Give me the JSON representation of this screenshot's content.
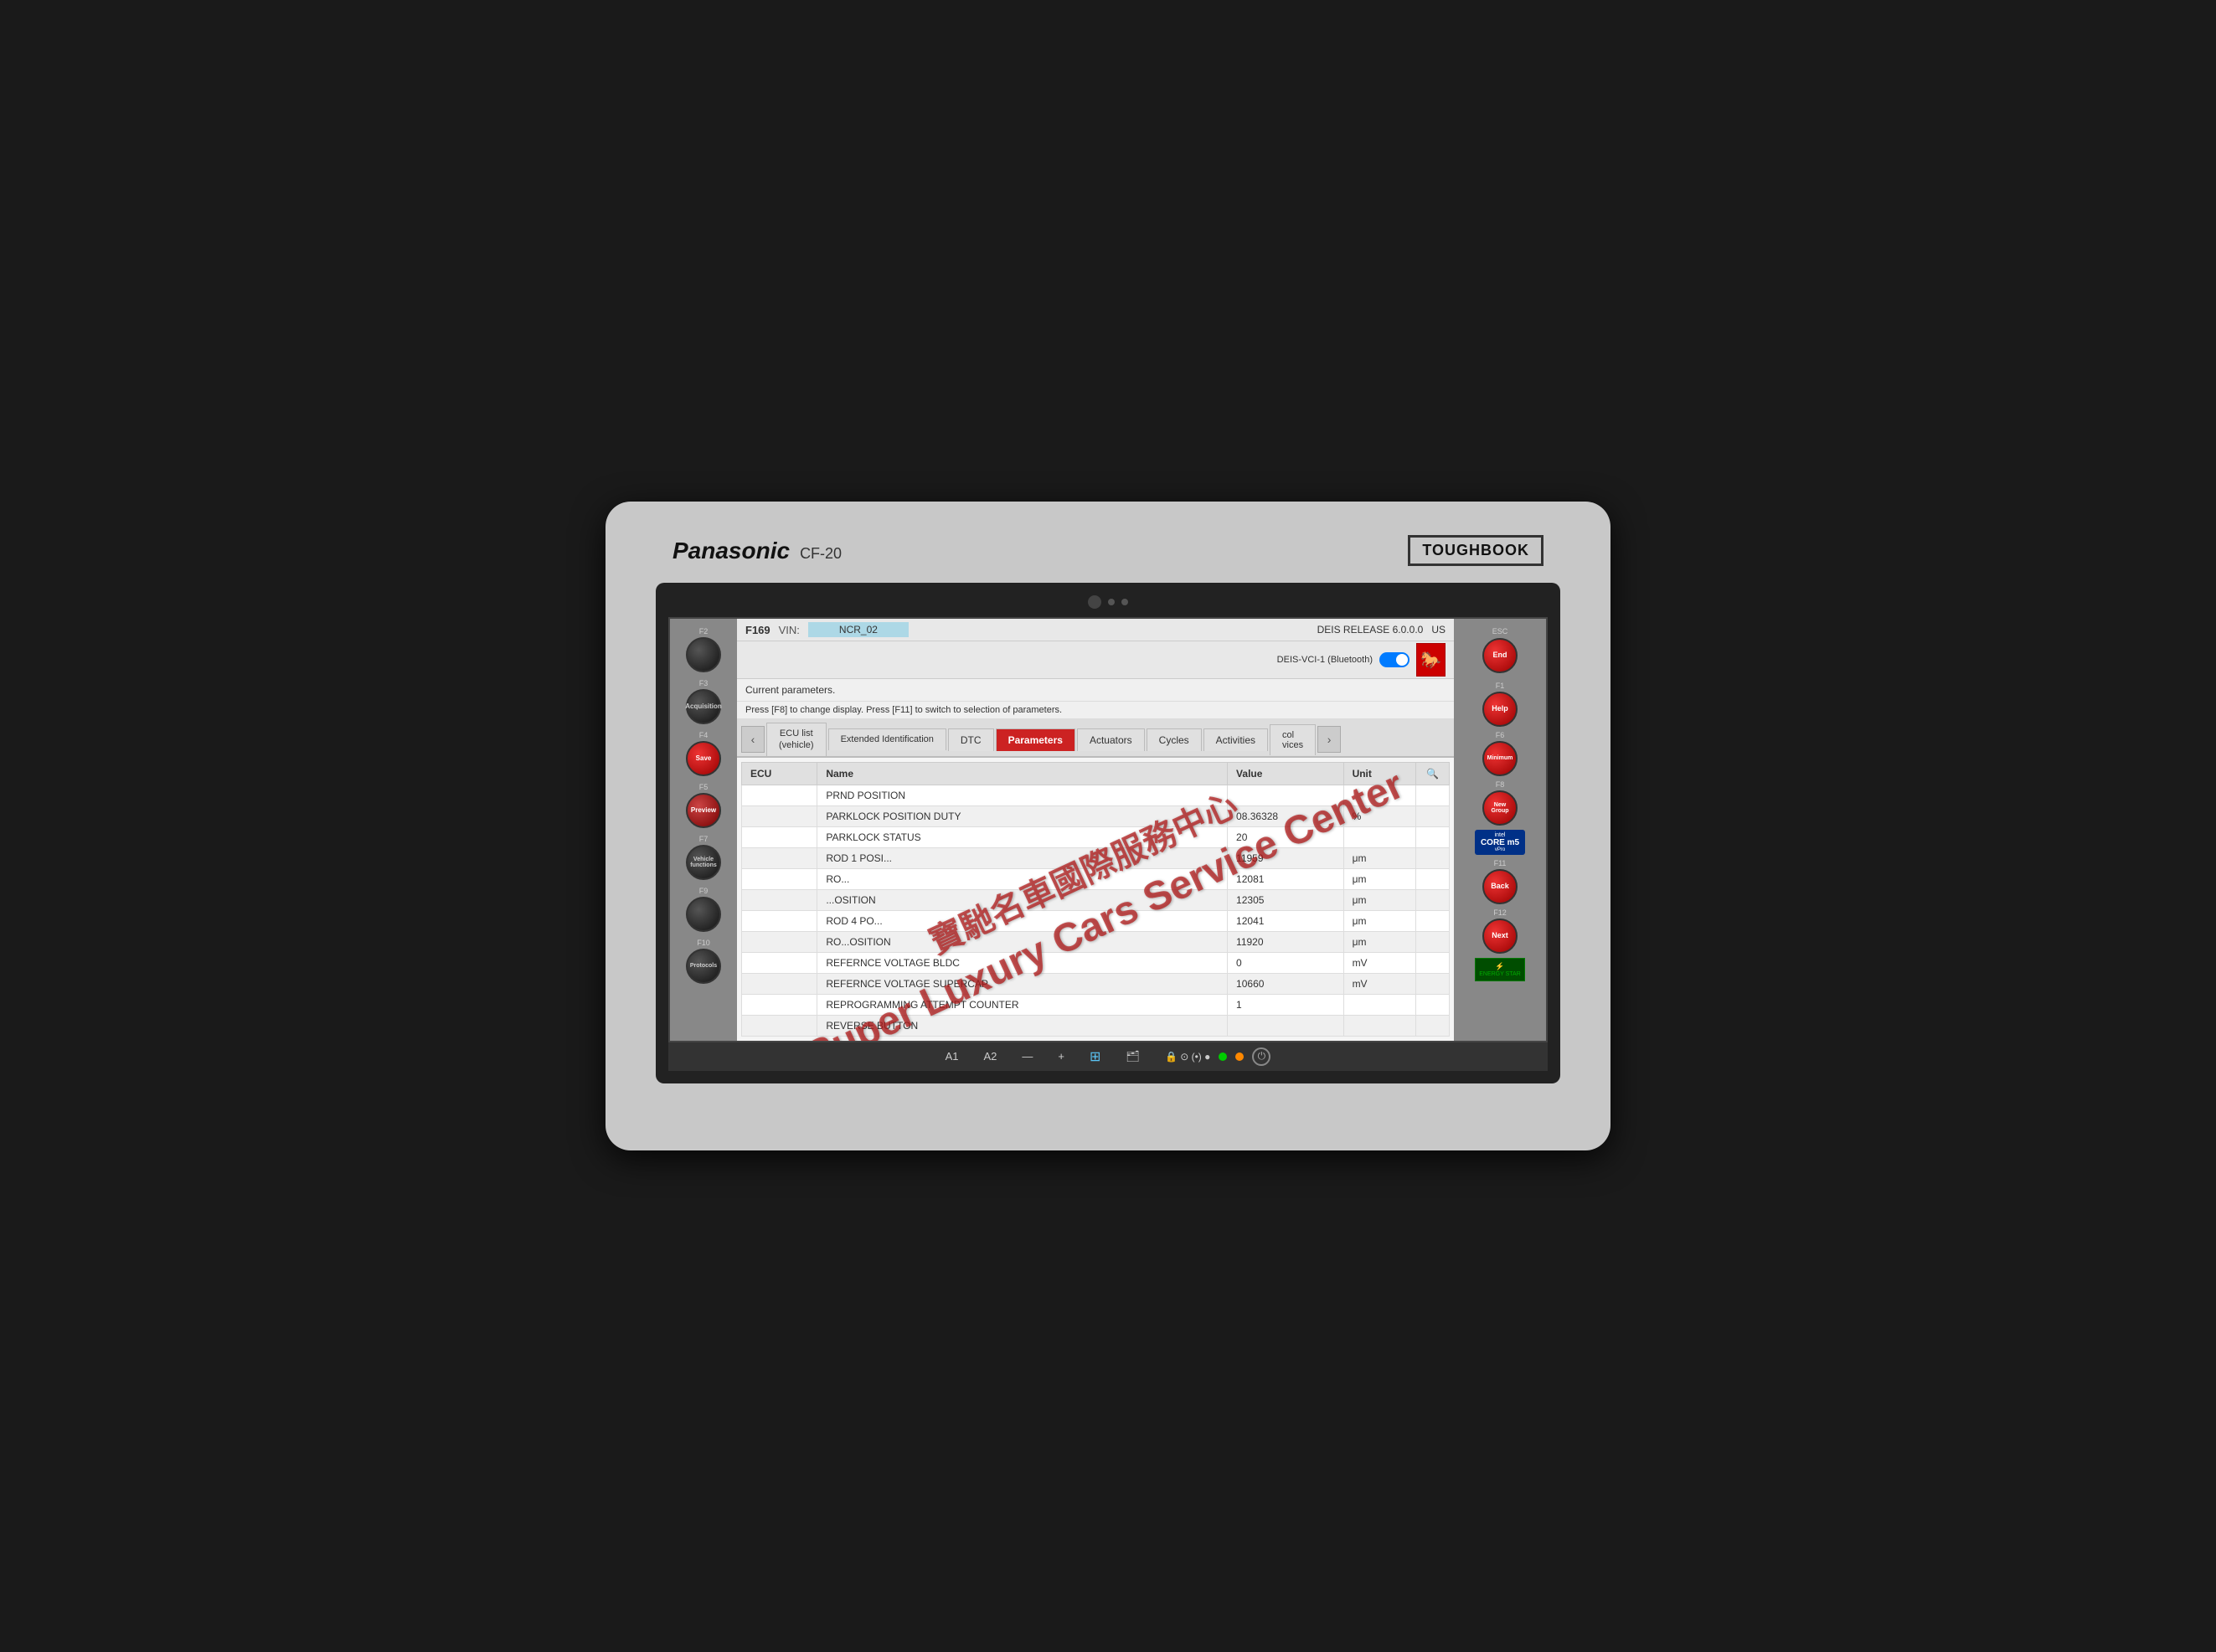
{
  "device": {
    "brand": "Panasonic",
    "model": "CF-20",
    "series": "TOUGHBOOK"
  },
  "header": {
    "f_code": "F169",
    "vin_label": "VIN:",
    "vin_value": "NCR_02",
    "deis_release": "DEIS RELEASE 6.0.0.0",
    "region": "US"
  },
  "info_bar": {
    "line1": "Current parameters.",
    "line2": "Press [F8] to change display. Press [F11] to switch to selection of parameters.",
    "connection": "DEIS-VCI-1 (Bluetooth)"
  },
  "tabs": [
    {
      "id": "ecu-list",
      "label": "ECU list\n(vehicle)",
      "active": false
    },
    {
      "id": "extended-id",
      "label": "Extended\nIdentification",
      "active": false
    },
    {
      "id": "dtc",
      "label": "DTC",
      "active": false
    },
    {
      "id": "parameters",
      "label": "Parameters",
      "active": true
    },
    {
      "id": "actuators",
      "label": "Actuators",
      "active": false
    },
    {
      "id": "cycles",
      "label": "Cycles",
      "active": false
    },
    {
      "id": "activities",
      "label": "Activities",
      "active": false
    },
    {
      "id": "protocol-services",
      "label": "col\nvices",
      "active": false
    }
  ],
  "table": {
    "columns": [
      "ECU",
      "Name",
      "Value",
      "Unit"
    ],
    "rows": [
      {
        "ecu": "",
        "name": "PRND POSITION",
        "value": "",
        "unit": ""
      },
      {
        "ecu": "",
        "name": "PARKLOCK POSITION DUTY",
        "value": "08.36328",
        "unit": "%"
      },
      {
        "ecu": "",
        "name": "PARKLOCK STATUS",
        "value": "20",
        "unit": ""
      },
      {
        "ecu": "",
        "name": "ROD 1 POSI...",
        "value": "11959",
        "unit": "μm"
      },
      {
        "ecu": "",
        "name": "RO...",
        "value": "12081",
        "unit": "μm"
      },
      {
        "ecu": "",
        "name": "...OSITION",
        "value": "12305",
        "unit": "μm"
      },
      {
        "ecu": "",
        "name": "ROD 4 PO...",
        "value": "12041",
        "unit": "μm"
      },
      {
        "ecu": "",
        "name": "RO...OSITION",
        "value": "11920",
        "unit": "μm"
      },
      {
        "ecu": "",
        "name": "REFERNCE VOLTAGE BLDC",
        "value": "0",
        "unit": "mV"
      },
      {
        "ecu": "",
        "name": "REFERNCE VOLTAGE SUPERCAP",
        "value": "10660",
        "unit": "mV"
      },
      {
        "ecu": "",
        "name": "REPROGRAMMING ATTEMPT COUNTER",
        "value": "1",
        "unit": ""
      },
      {
        "ecu": "",
        "name": "REVERSE BUTTON",
        "value": "",
        "unit": ""
      }
    ]
  },
  "watermark": {
    "line1": "寶馳名車國際服務中心",
    "line2": "Super Luxury Cars Service Center"
  },
  "left_buttons": [
    {
      "fn": "F2",
      "label": "",
      "style": "black"
    },
    {
      "fn": "F3",
      "label": "Acquisition",
      "style": "black"
    },
    {
      "fn": "F4",
      "label": "Save",
      "style": "red"
    },
    {
      "fn": "F5",
      "label": "Preview",
      "style": "red"
    },
    {
      "fn": "F7",
      "label": "Vehicle\nfunctions",
      "style": "black"
    },
    {
      "fn": "F9",
      "label": "",
      "style": "black"
    },
    {
      "fn": "F10",
      "label": "Protocols",
      "style": "black"
    }
  ],
  "right_buttons": [
    {
      "fn": "ESC",
      "label": "End",
      "style": "red"
    },
    {
      "fn": "F1",
      "label": "Help",
      "style": "red"
    },
    {
      "fn": "F6",
      "label": "Minimum",
      "style": "red"
    },
    {
      "fn": "F8",
      "label": "New\nGroup",
      "style": "red"
    },
    {
      "fn": "F11",
      "label": "Back",
      "style": "red"
    },
    {
      "fn": "F12",
      "label": "Next",
      "style": "red"
    }
  ],
  "taskbar": {
    "items": [
      "A1",
      "A2",
      "—",
      "+"
    ],
    "power": "⏻"
  }
}
